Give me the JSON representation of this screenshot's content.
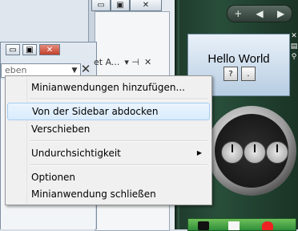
{
  "background_window": {
    "buttons": [
      "▭",
      "▣",
      "✕"
    ]
  },
  "sidebar": {
    "controls": {
      "add": "+",
      "prev": "◀",
      "next": "▶"
    },
    "hello_gadget": {
      "title": "Hello World",
      "buttons": [
        "?",
        "."
      ],
      "tools": [
        "✕",
        "▤",
        "⚲"
      ]
    }
  },
  "dock_window": {
    "buttons": [
      "▭",
      "▣",
      "✕"
    ],
    "input_value": "eben",
    "panel_title": "et A...",
    "panel_pin": "▾ ⊣",
    "close": "✕"
  },
  "menu": {
    "items": [
      {
        "label": "Minianwendungen hinzufügen..."
      },
      {
        "label": "Von der Sidebar abdocken",
        "highlighted": true
      },
      {
        "label": "Verschieben"
      },
      {
        "label": "Undurchsichtigkeit",
        "submenu": true
      },
      {
        "label": "Optionen"
      },
      {
        "label": "Minianwendung schließen"
      }
    ]
  },
  "colors": {
    "sidebar_green": "#284e3a",
    "menu_bg": "#f0f0f0",
    "menu_highlight": "#d9ecfd"
  }
}
